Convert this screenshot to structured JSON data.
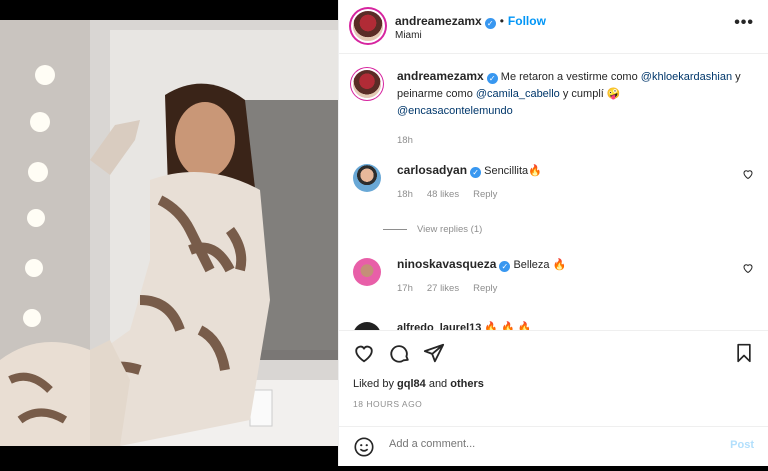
{
  "header": {
    "username": "andreamezamx",
    "separator": "•",
    "follow_label": "Follow",
    "location": "Miami",
    "more_glyph": "•••"
  },
  "caption": {
    "username": "andreamezamx",
    "text_1": "Me retaron a vestirme como ",
    "mention_1": "@khloekardashian",
    "text_2": " y peinarme como ",
    "mention_2": "@camila_cabello",
    "text_3": " y cumplí 🤪",
    "mention_3": "@encasacontelemundo",
    "time": "18h"
  },
  "comments": [
    {
      "username": "carlosadyan",
      "text": "Sencillita🔥",
      "time": "18h",
      "likes": "48 likes",
      "reply": "Reply"
    },
    {
      "username": "ninoskavasqueza",
      "text": "Belleza 🔥",
      "time": "17h",
      "likes": "27 likes",
      "reply": "Reply"
    }
  ],
  "view_replies": "View replies (1)",
  "partial_comment": "alfredo_laurel13 🔥 🔥 🔥",
  "likes": {
    "prefix": "Liked by ",
    "user": "gql84",
    "middle": " and ",
    "others": "others"
  },
  "time_ago": "18 HOURS AGO",
  "add_comment": {
    "placeholder": "Add a comment...",
    "post_label": "Post"
  },
  "colors": {
    "accent": "#0095f6",
    "verified": "#3897f0",
    "muted": "#8e8e8e"
  }
}
